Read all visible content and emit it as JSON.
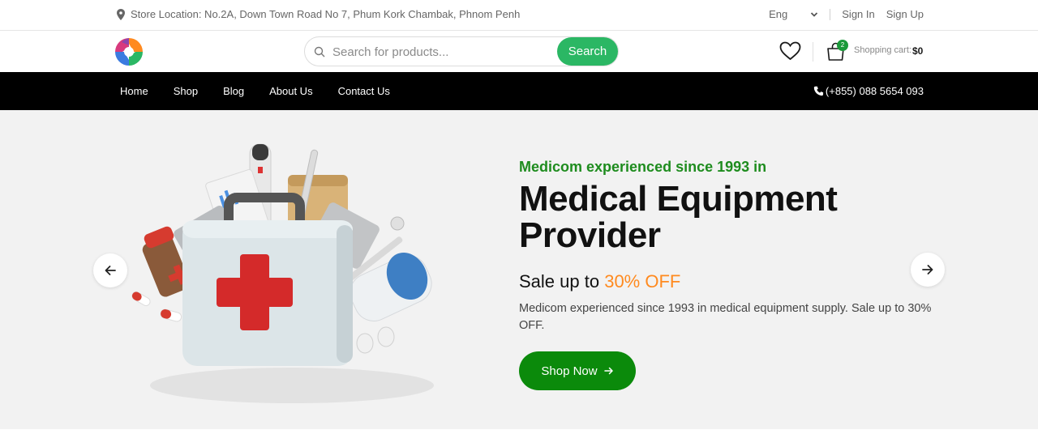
{
  "topbar": {
    "location": "Store Location: No.2A, Down Town Road No 7, Phum Kork Chambak, Phnom Penh",
    "language": "Eng",
    "sign_in": "Sign In",
    "sign_up": "Sign Up"
  },
  "header": {
    "search_placeholder": "Search for products...",
    "search_button": "Search",
    "cart_count": "2",
    "cart_label": "Shopping cart:",
    "cart_total": "$0"
  },
  "nav": {
    "items": [
      "Home",
      "Shop",
      "Blog",
      "About Us",
      "Contact Us"
    ],
    "phone": "(+855) 088 5654 093"
  },
  "hero": {
    "eyebrow": "Medicom experienced since 1993 in",
    "headline_line1": "Medical Equipment",
    "headline_line2": "Provider",
    "sale_prefix": "Sale up to",
    "sale_accent": "30% OFF",
    "description": "Medicom experienced since 1993 in medical equipment supply. Sale up to 30% OFF.",
    "cta": "Shop Now"
  },
  "icons": [
    "location-pin-icon",
    "chevron-down-icon",
    "search-icon",
    "heart-icon",
    "cart-icon",
    "phone-icon",
    "arrow-left-icon",
    "arrow-right-icon"
  ],
  "colors": {
    "accent_green": "#2bb764",
    "cta_green": "#0b8a0b",
    "eyebrow_green": "#1e8c1e",
    "sale_orange": "#ff8a1f",
    "nav_bg": "#000000",
    "hero_bg": "#f2f2f2"
  }
}
